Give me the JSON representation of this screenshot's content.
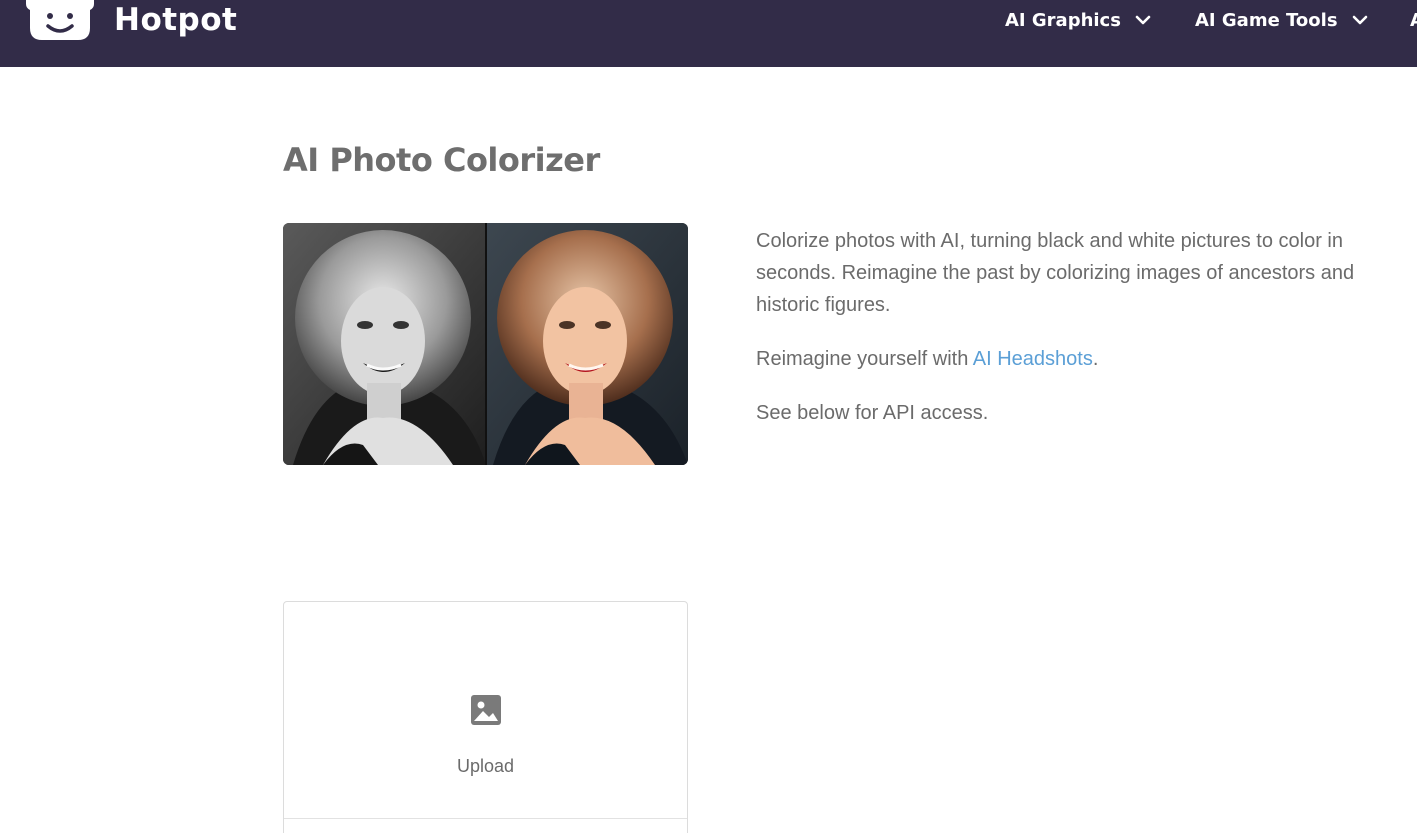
{
  "brand": {
    "name": "Hotpot",
    "logo": "chef-hat-smiley-logo"
  },
  "nav": {
    "items": [
      {
        "label": "AI Graphics",
        "icon": "chevron-down-icon"
      },
      {
        "label": "AI Game Tools",
        "icon": "chevron-down-icon"
      },
      {
        "label": "A"
      }
    ]
  },
  "colors": {
    "header_bg": "#322c48",
    "link": "#5b9fd6",
    "text": "#6b6b6b"
  },
  "main": {
    "title": "AI Photo Colorizer",
    "hero_image": "black-and-white vs colorized portrait comparison",
    "description": {
      "p1": "Colorize photos with AI, turning black and white pictures to color in seconds. Reimagine the past by colorizing images of ancestors and historic figures.",
      "p2_prefix": "Reimagine yourself with ",
      "p2_link": "AI Headshots",
      "p2_suffix": ".",
      "p3": "See below for API access."
    },
    "upload": {
      "label": "Upload",
      "icon": "image-icon"
    }
  }
}
